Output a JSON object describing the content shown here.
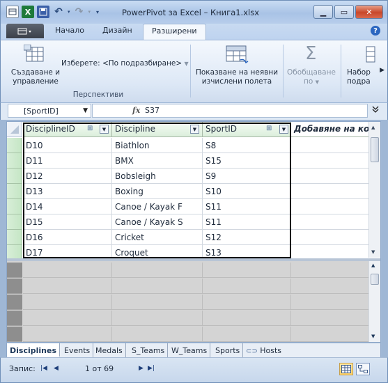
{
  "window": {
    "title": "PowerPivot за Excel – Книга1.xlsx"
  },
  "ribbon_tabs": [
    "Начало",
    "Дизайн",
    "Разширени"
  ],
  "ribbon": {
    "create_manage": [
      "Създаване и",
      "управление"
    ],
    "choose_perspective": "Изберете: <По подразбиране>",
    "perspectives_group": "Перспективи",
    "show_hidden": [
      "Показване на неявни",
      "изчислени полета"
    ],
    "summarize": [
      "Обобщаване",
      "по"
    ],
    "default_field_set": [
      "Набор",
      "подра"
    ]
  },
  "formula_bar": {
    "name_box": "[SportID]",
    "fx": "fx",
    "value": "S37"
  },
  "grid": {
    "columns": [
      "DisciplineID",
      "Discipline",
      "SportID"
    ],
    "add_column": "Добавяне на колона",
    "rows": [
      [
        "D10",
        "Biathlon",
        "S8"
      ],
      [
        "D11",
        "BMX",
        "S15"
      ],
      [
        "D12",
        "Bobsleigh",
        "S9"
      ],
      [
        "D13",
        "Boxing",
        "S10"
      ],
      [
        "D14",
        "Canoe / Kayak F",
        "S11"
      ],
      [
        "D15",
        "Canoe / Kayak S",
        "S11"
      ],
      [
        "D16",
        "Cricket",
        "S12"
      ],
      [
        "D17",
        "Croquet",
        "S13"
      ]
    ]
  },
  "sheet_tabs": [
    "Disciplines",
    "Events",
    "Medals",
    "S_Teams",
    "W_Teams",
    "Sports",
    "Hosts"
  ],
  "status": {
    "record_label": "Запис:",
    "count": "1 от 69"
  },
  "colors": {
    "accent": "#2b66c0",
    "header_green": "#dcefdc",
    "selection": "#000000"
  }
}
